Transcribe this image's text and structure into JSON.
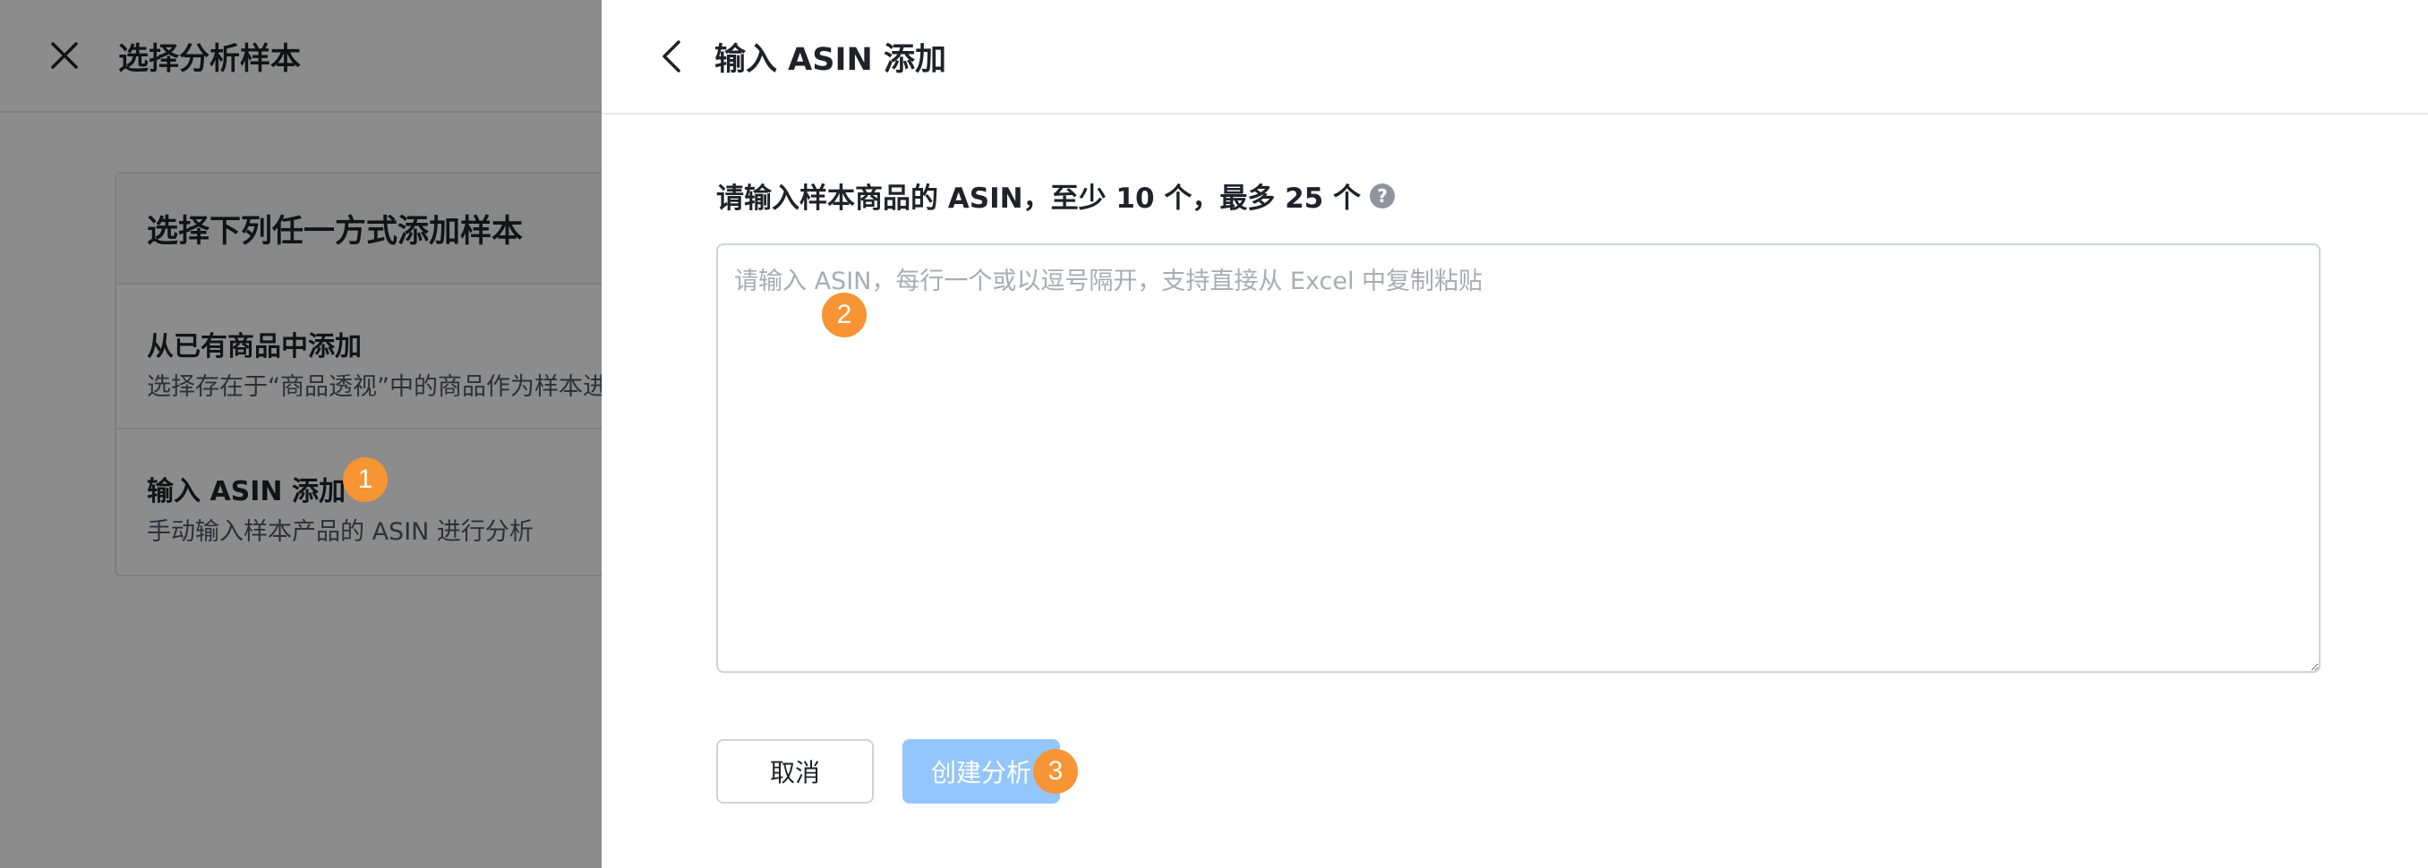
{
  "left_panel": {
    "title": "选择分析样本",
    "card_header": "选择下列任一方式添加样本",
    "options": [
      {
        "title": "从已有商品中添加",
        "desc": "选择存在于“商品透视”中的商品作为样本进行分析"
      },
      {
        "title": "输入 ASIN 添加",
        "desc": "手动输入样本产品的 ASIN 进行分析"
      }
    ]
  },
  "drawer": {
    "title": "输入 ASIN 添加",
    "field_label": "请输入样本商品的 ASIN，至少 10 个，最多 25 个",
    "help_glyph": "?",
    "textarea": {
      "value": "",
      "placeholder": "请输入 ASIN，每行一个或以逗号隔开，支持直接从 Excel 中复制粘贴"
    },
    "cancel_label": "取消",
    "create_label": "创建分析"
  },
  "badges": [
    "1",
    "2",
    "3"
  ],
  "colors": {
    "badge": "#f79433",
    "primary_disabled": "#94c5fb",
    "overlay": "rgba(0,0,0,0.45)"
  },
  "icons": {
    "close": "close-icon",
    "back": "chevron-left-icon",
    "help": "question-circle-icon"
  }
}
